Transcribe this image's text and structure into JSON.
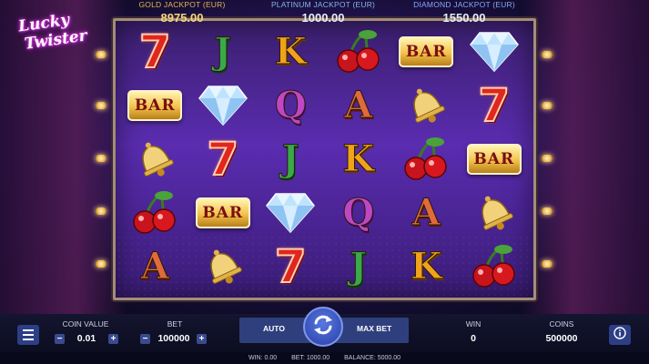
{
  "jackpots": {
    "gold": {
      "label": "GOLD JACKPOT (EUR)",
      "value": "8975.00"
    },
    "platinum": {
      "label": "PLATINUM JACKPOT (EUR)",
      "value": "1000.00"
    },
    "diamond": {
      "label": "DIAMOND JACKPOT (EUR)",
      "value": "1550.00"
    }
  },
  "reels": [
    [
      "seven",
      "J",
      "K",
      "cherry",
      "bar",
      "diamond"
    ],
    [
      "bar",
      "diamond",
      "Q",
      "A",
      "bell",
      "seven"
    ],
    [
      "bell",
      "seven",
      "J",
      "K",
      "cherry",
      "bar"
    ],
    [
      "cherry",
      "bar",
      "diamond",
      "Q",
      "A",
      "bell"
    ],
    [
      "A",
      "bell",
      "seven",
      "J",
      "K",
      "cherry"
    ]
  ],
  "symbol_text": {
    "bar": "BAR",
    "seven": "7"
  },
  "controls": {
    "coin_value_label": "COIN VALUE",
    "coin_value": "0.01",
    "bet_label": "BET",
    "bet": "100000",
    "auto_label": "AUTO",
    "max_bet_label": "MAX BET",
    "win_label": "WIN",
    "win": "0",
    "coins_label": "COINS",
    "coins": "500000",
    "minus": "−",
    "plus": "+"
  },
  "status": {
    "win": "WIN: 0.00",
    "bet": "BET: 1000.00",
    "balance": "BALANCE: 5000.00"
  },
  "icons": {
    "menu": "hamburger-icon",
    "spin": "refresh-arrows-icon",
    "info": "info-icon"
  },
  "colors": {
    "button_blue": "#2c3f86",
    "spin_blue": "#3650b8",
    "gold_text": "#e4b64a"
  }
}
